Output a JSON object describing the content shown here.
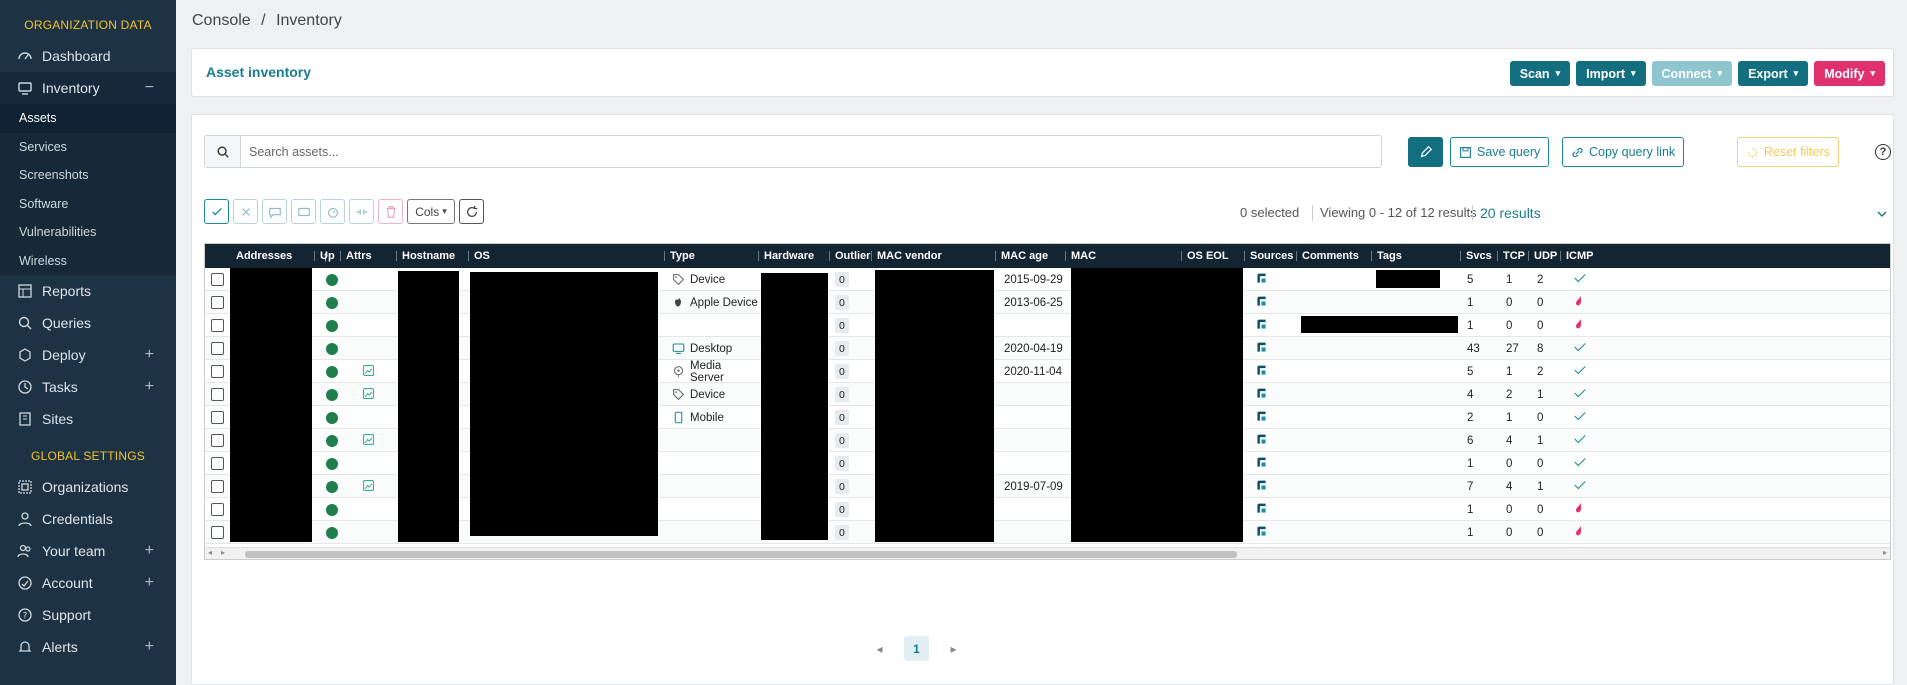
{
  "sidebar": {
    "section_org": "ORGANIZATION DATA",
    "section_global": "GLOBAL SETTINGS",
    "dashboard": "Dashboard",
    "inventory": "Inventory",
    "inventory_toggle": "−",
    "sub": [
      "Assets",
      "Services",
      "Screenshots",
      "Software",
      "Vulnerabilities",
      "Wireless"
    ],
    "reports": "Reports",
    "queries": "Queries",
    "deploy": "Deploy",
    "tasks": "Tasks",
    "sites": "Sites",
    "organizations": "Organizations",
    "credentials": "Credentials",
    "your_team": "Your team",
    "account": "Account",
    "support": "Support",
    "alerts": "Alerts",
    "plus": "+"
  },
  "breadcrumb": {
    "root": "Console",
    "sep": "/",
    "current": "Inventory"
  },
  "header": {
    "title": "Asset inventory",
    "buttons": {
      "scan": "Scan",
      "import": "Import",
      "connect": "Connect",
      "export": "Export",
      "modify": "Modify"
    },
    "caret": "▾"
  },
  "search": {
    "placeholder": "Search assets...",
    "save_query": "Save query",
    "copy_link": "Copy query link",
    "reset_filters": "Reset filters",
    "help": "?"
  },
  "toolbar": {
    "cols": "Cols",
    "cols_caret": "▾"
  },
  "status": {
    "selected": "0 selected",
    "viewing": "Viewing 0 - 12 of 12 results",
    "per_page": "20 results"
  },
  "table": {
    "columns": [
      "Addresses",
      "Up",
      "Attrs",
      "Hostname",
      "OS",
      "Type",
      "Hardware",
      "Outlier",
      "MAC vendor",
      "MAC age",
      "MAC",
      "OS EOL",
      "Sources",
      "Comments",
      "Tags",
      "Svcs",
      "TCP",
      "UDP",
      "ICMP"
    ],
    "rows": [
      {
        "attr": false,
        "type": "Device",
        "type_icon": "tag-icon",
        "outlier": "0",
        "mac_age": "2015-09-29",
        "svcs": "5",
        "tcp": "1",
        "udp": "2",
        "icmp": "check"
      },
      {
        "attr": false,
        "type": "Apple Device",
        "type_icon": "apple-icon",
        "outlier": "0",
        "mac_age": "2013-06-25",
        "svcs": "1",
        "tcp": "0",
        "udp": "0",
        "icmp": "flame"
      },
      {
        "attr": false,
        "type": "",
        "type_icon": "",
        "outlier": "0",
        "mac_age": "",
        "svcs": "1",
        "tcp": "0",
        "udp": "0",
        "icmp": "flame"
      },
      {
        "attr": false,
        "type": "Desktop",
        "type_icon": "monitor-icon",
        "outlier": "0",
        "mac_age": "2020-04-19",
        "svcs": "43",
        "tcp": "27",
        "udp": "8",
        "icmp": "check"
      },
      {
        "attr": true,
        "type": "Media Server",
        "type_icon": "media-server-icon",
        "outlier": "0",
        "mac_age": "2020-11-04",
        "svcs": "5",
        "tcp": "1",
        "udp": "2",
        "icmp": "check"
      },
      {
        "attr": true,
        "type": "Device",
        "type_icon": "tag-icon",
        "outlier": "0",
        "mac_age": "",
        "svcs": "4",
        "tcp": "2",
        "udp": "1",
        "icmp": "check"
      },
      {
        "attr": false,
        "type": "Mobile",
        "type_icon": "mobile-icon",
        "outlier": "0",
        "mac_age": "",
        "svcs": "2",
        "tcp": "1",
        "udp": "0",
        "icmp": "check"
      },
      {
        "attr": true,
        "type": "",
        "type_icon": "",
        "outlier": "0",
        "mac_age": "",
        "svcs": "6",
        "tcp": "4",
        "udp": "1",
        "icmp": "check"
      },
      {
        "attr": false,
        "type": "",
        "type_icon": "",
        "outlier": "0",
        "mac_age": "",
        "svcs": "1",
        "tcp": "0",
        "udp": "0",
        "icmp": "check"
      },
      {
        "attr": true,
        "type": "",
        "type_icon": "",
        "outlier": "0",
        "mac_age": "2019-07-09",
        "svcs": "7",
        "tcp": "4",
        "udp": "1",
        "icmp": "check"
      },
      {
        "attr": false,
        "type": "",
        "type_icon": "",
        "outlier": "0",
        "mac_age": "",
        "svcs": "1",
        "tcp": "0",
        "udp": "0",
        "icmp": "flame"
      },
      {
        "attr": false,
        "type": "",
        "type_icon": "",
        "outlier": "0",
        "mac_age": "",
        "svcs": "1",
        "tcp": "0",
        "udp": "0",
        "icmp": "flame"
      }
    ]
  },
  "pagination": {
    "prev": "◂",
    "current": "1",
    "next": "▸"
  },
  "colors": {
    "accent": "#136f80",
    "sidebar": "#1d3242",
    "pink": "#e0316f",
    "up": "#1e7f4c"
  }
}
